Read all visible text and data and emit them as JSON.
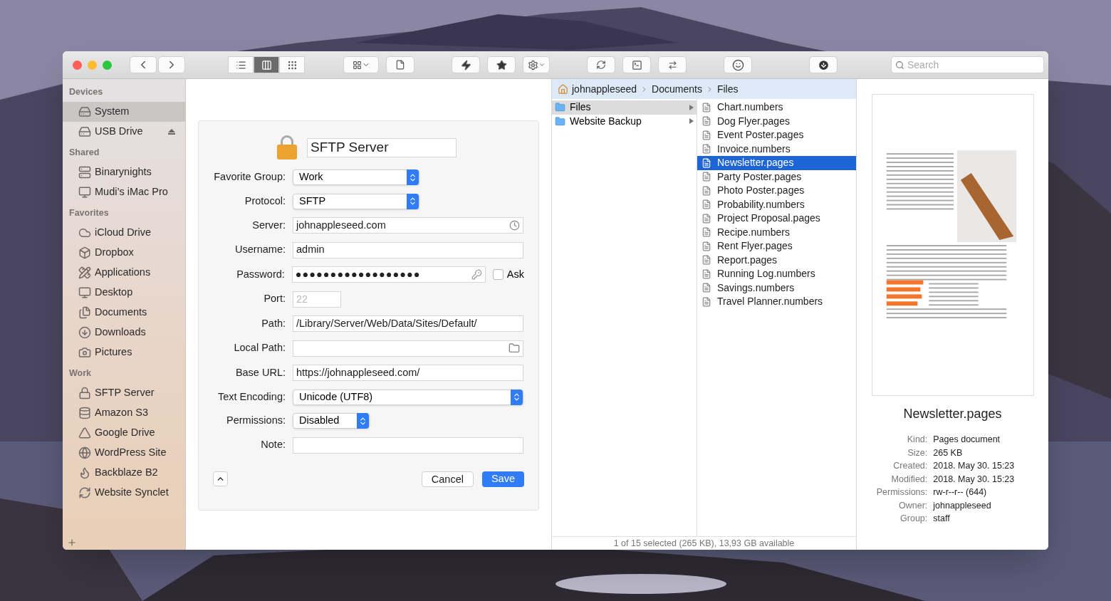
{
  "toolbar": {
    "view_modes": [
      {
        "selected": false
      },
      {
        "selected": true
      },
      {
        "selected": false
      }
    ],
    "search": {
      "placeholder": "Search"
    }
  },
  "sidebar": {
    "sections": [
      {
        "title": "Devices",
        "items": [
          {
            "label": "System",
            "selected": true,
            "eject": false
          },
          {
            "label": "USB Drive",
            "selected": false,
            "eject": true
          }
        ]
      },
      {
        "title": "Shared",
        "items": [
          {
            "label": "Binarynights",
            "selected": false,
            "eject": false
          },
          {
            "label": "Mudi’s iMac Pro",
            "selected": false,
            "eject": false
          }
        ]
      },
      {
        "title": "Favorites",
        "items": [
          {
            "label": "iCloud Drive",
            "selected": false,
            "eject": false
          },
          {
            "label": "Dropbox",
            "selected": false,
            "eject": false
          },
          {
            "label": "Applications",
            "selected": false,
            "eject": false
          },
          {
            "label": "Desktop",
            "selected": false,
            "eject": false
          },
          {
            "label": "Documents",
            "selected": false,
            "eject": false
          },
          {
            "label": "Downloads",
            "selected": false,
            "eject": false
          },
          {
            "label": "Pictures",
            "selected": false,
            "eject": false
          }
        ]
      },
      {
        "title": "Work",
        "items": [
          {
            "label": "SFTP Server",
            "selected": false,
            "eject": false
          },
          {
            "label": "Amazon S3",
            "selected": false,
            "eject": false
          },
          {
            "label": "Google Drive",
            "selected": false,
            "eject": false
          },
          {
            "label": "WordPress Site",
            "selected": false,
            "eject": false
          },
          {
            "label": "Backblaze B2",
            "selected": false,
            "eject": false
          },
          {
            "label": "Website Synclet",
            "selected": false,
            "eject": false
          }
        ]
      }
    ]
  },
  "form": {
    "name": "SFTP Server",
    "fields": [
      {
        "label": "Favorite Group:",
        "kind": "select",
        "value": "Work"
      },
      {
        "label": "Protocol:",
        "kind": "select",
        "value": "SFTP"
      },
      {
        "label": "Server:",
        "kind": "history",
        "value": "johnappleseed.com"
      },
      {
        "label": "Username:",
        "kind": "text",
        "value": "admin"
      },
      {
        "label": "Password:",
        "kind": "password",
        "value": "●●●●●●●●●●●●●●●●●●",
        "ask": {
          "label": "Ask",
          "checked": false
        }
      },
      {
        "label": "Port:",
        "kind": "short",
        "placeholder": "22"
      },
      {
        "label": "Path:",
        "kind": "text",
        "value": "/Library/Server/Web/Data/Sites/Default/"
      },
      {
        "label": "Local Path:",
        "kind": "folder"
      },
      {
        "label": "Base URL:",
        "kind": "text",
        "value": "https://johnappleseed.com/"
      },
      {
        "label": "Text Encoding:",
        "kind": "wideselect",
        "value": "Unicode (UTF8)"
      },
      {
        "label": "Permissions:",
        "kind": "smallselect",
        "value": "Disabled"
      },
      {
        "label": "Note:",
        "kind": "text"
      }
    ],
    "buttons": [
      {
        "label": "Cancel",
        "primary": false
      },
      {
        "label": "Save",
        "primary": true
      }
    ]
  },
  "browser": {
    "breadcrumb": [
      "johnappleseed",
      "Documents",
      "Files"
    ],
    "folders": [
      {
        "name": "Files",
        "selected": true
      },
      {
        "name": "Website Backup",
        "selected": false
      }
    ],
    "files": [
      {
        "name": "Chart.numbers",
        "selected": false
      },
      {
        "name": "Dog Flyer.pages",
        "selected": false
      },
      {
        "name": "Event Poster.pages",
        "selected": false
      },
      {
        "name": "Invoice.numbers",
        "selected": false
      },
      {
        "name": "Newsletter.pages",
        "selected": true
      },
      {
        "name": "Party Poster.pages",
        "selected": false
      },
      {
        "name": "Photo Poster.pages",
        "selected": false
      },
      {
        "name": "Probability.numbers",
        "selected": false
      },
      {
        "name": "Project Proposal.pages",
        "selected": false
      },
      {
        "name": "Recipe.numbers",
        "selected": false
      },
      {
        "name": "Rent Flyer.pages",
        "selected": false
      },
      {
        "name": "Report.pages",
        "selected": false
      },
      {
        "name": "Running Log.numbers",
        "selected": false
      },
      {
        "name": "Savings.numbers",
        "selected": false
      },
      {
        "name": "Travel Planner.numbers",
        "selected": false
      }
    ],
    "status": "1 of 15 selected (265 KB), 13,93 GB available"
  },
  "preview": {
    "title": "Newsletter.pages",
    "info": [
      {
        "label": "Kind:",
        "value": "Pages document"
      },
      {
        "label": "Size:",
        "value": "265 KB"
      },
      {
        "label": "Created:",
        "value": "2018. May 30. 15:23"
      },
      {
        "label": "Modified:",
        "value": "2018. May 30. 15:23"
      },
      {
        "label": "Permissions:",
        "value": "rw-r--r-- (644)"
      },
      {
        "label": "Owner:",
        "value": "johnappleseed"
      },
      {
        "label": "Group:",
        "value": "staff"
      }
    ]
  }
}
